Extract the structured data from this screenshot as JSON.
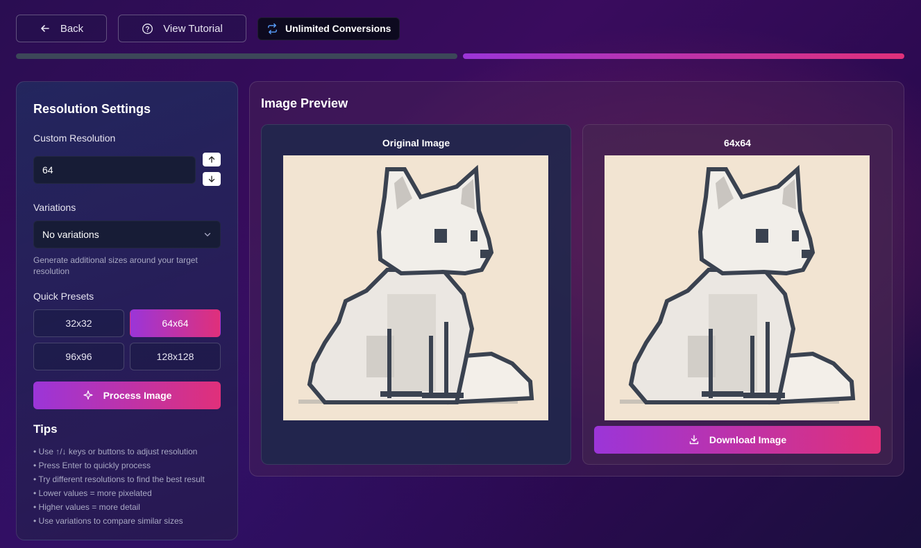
{
  "topbar": {
    "back_label": "Back",
    "tutorial_label": "View Tutorial",
    "badge_label": "Unlimited Conversions"
  },
  "progress": {
    "steps_total": 2,
    "current_step": 2
  },
  "settings": {
    "title": "Resolution Settings",
    "custom_resolution_label": "Custom Resolution",
    "resolution_value": "64",
    "variations_label": "Variations",
    "variations_selected": "No variations",
    "variations_hint": "Generate additional sizes around your target resolution",
    "presets_label": "Quick Presets",
    "presets": [
      {
        "label": "32x32",
        "active": false
      },
      {
        "label": "64x64",
        "active": true
      },
      {
        "label": "96x96",
        "active": false
      },
      {
        "label": "128x128",
        "active": false
      }
    ],
    "process_label": "Process Image",
    "tips_title": "Tips",
    "tips": [
      "Use ↑/↓ keys or buttons to adjust resolution",
      "Press Enter to quickly process",
      "Try different resolutions to find the best result",
      "Lower values = more pixelated",
      "Higher values = more detail",
      "Use variations to compare similar sizes"
    ]
  },
  "preview": {
    "title": "Image Preview",
    "original_title": "Original Image",
    "result_title": "64x64",
    "download_label": "Download Image",
    "image_subject": "pixel-art-fox"
  },
  "colors": {
    "accent_start": "#9b35d8",
    "accent_end": "#e0307a",
    "image_bg": "#f2e4d2",
    "outline": "#3a4250"
  }
}
